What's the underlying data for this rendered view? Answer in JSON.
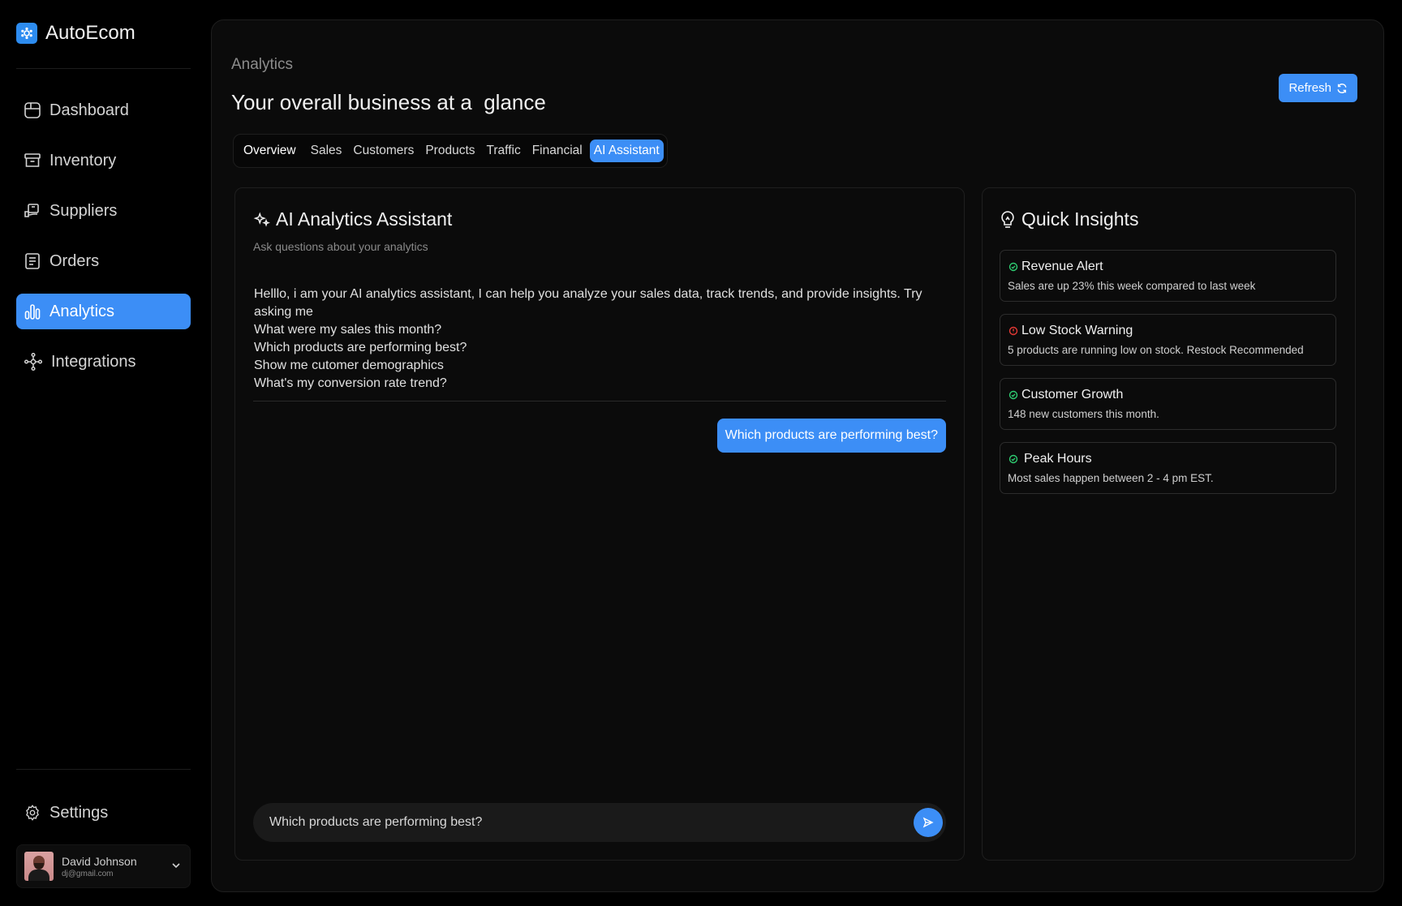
{
  "brand": {
    "name": "AutoEcom",
    "icon": "logo-icon"
  },
  "sidebar": {
    "items": [
      {
        "label": "Dashboard",
        "icon": "dashboard-icon",
        "active": false
      },
      {
        "label": "Inventory",
        "icon": "inventory-icon",
        "active": false
      },
      {
        "label": "Suppliers",
        "icon": "suppliers-icon",
        "active": false
      },
      {
        "label": "Orders",
        "icon": "orders-icon",
        "active": false
      },
      {
        "label": "Analytics",
        "icon": "analytics-icon",
        "active": true
      },
      {
        "label": "Integrations",
        "icon": "integrations-icon",
        "active": false
      }
    ],
    "settings_label": "Settings",
    "user": {
      "name": "David Johnson",
      "email": "dj@gmail.com"
    }
  },
  "header": {
    "breadcrumb": "Analytics",
    "title": "Your overall business at a  glance",
    "refresh_label": "Refresh"
  },
  "tabs": [
    {
      "label": "Overview",
      "active": false
    },
    {
      "label": "Sales",
      "active": false
    },
    {
      "label": "Customers",
      "active": false
    },
    {
      "label": "Products",
      "active": false
    },
    {
      "label": "Traffic",
      "active": false
    },
    {
      "label": "Financial",
      "active": false
    },
    {
      "label": "AI Assistant",
      "active": true
    }
  ],
  "chat": {
    "title": "AI Analytics Assistant",
    "subtitle": "Ask questions about your analytics",
    "assistant_lines": [
      "Helllo, i am your AI analytics assistant, I can help you analyze your sales data, track trends, and provide insights. Try",
      "asking me",
      "What were my sales this month?",
      "Which products are performing best?",
      "Show me cutomer demographics",
      "What's my conversion rate trend?"
    ],
    "user_message": "Which products are performing best?",
    "input_value": "Which products are performing best?"
  },
  "insights": {
    "title": "Quick Insights",
    "items": [
      {
        "title": "Revenue Alert",
        "desc": "Sales are up 23% this week compared to last week",
        "status": "positive",
        "color": "#2ecc71"
      },
      {
        "title": "Low Stock Warning",
        "desc": "5 products are running low on stock. Restock Recommended",
        "status": "warning",
        "color": "#e53935"
      },
      {
        "title": "Customer Growth",
        "desc": "148 new customers this month.",
        "status": "positive",
        "color": "#2ecc71"
      },
      {
        "title": "Peak Hours",
        "desc": "Most sales happen between 2 - 4 pm EST.",
        "status": "positive",
        "color": "#2ecc71"
      }
    ]
  },
  "colors": {
    "accent": "#3c8ef6",
    "background": "#000000",
    "panel": "#0b0b0b"
  }
}
